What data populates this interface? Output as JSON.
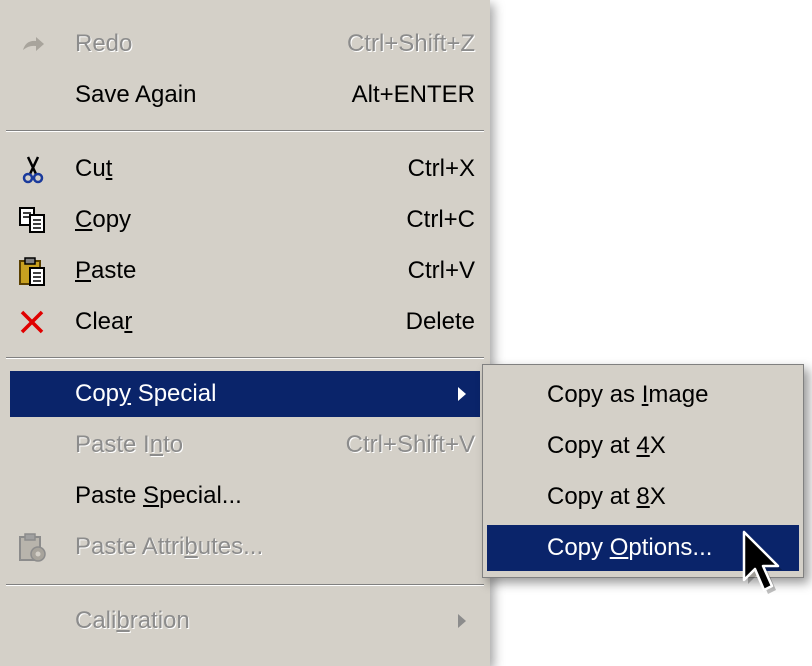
{
  "main_menu": {
    "items": [
      {
        "pre": "Redo",
        "u": "",
        "post": "",
        "shortcut": "Ctrl+Shift+Z",
        "icon": "redo-icon"
      },
      {
        "pre": "Save Again",
        "u": "",
        "post": "",
        "shortcut": "Alt+ENTER"
      },
      {
        "pre": "Cu",
        "u": "t",
        "post": "",
        "shortcut": "Ctrl+X",
        "icon": "scissors-icon"
      },
      {
        "pre": "",
        "u": "C",
        "post": "opy",
        "shortcut": "Ctrl+C",
        "icon": "copy-icon"
      },
      {
        "pre": "",
        "u": "P",
        "post": "aste",
        "shortcut": "Ctrl+V",
        "icon": "clipboard-icon"
      },
      {
        "pre": "Clea",
        "u": "r",
        "post": "",
        "shortcut": "Delete",
        "icon": "delete-x-icon"
      },
      {
        "pre": "Cop",
        "u": "y",
        "post": " Special",
        "shortcut": ""
      },
      {
        "pre": "Paste I",
        "u": "n",
        "post": "to",
        "shortcut": "Ctrl+Shift+V"
      },
      {
        "pre": "Paste ",
        "u": "S",
        "post": "pecial...",
        "shortcut": ""
      },
      {
        "pre": "Paste Attri",
        "u": "b",
        "post": "utes...",
        "shortcut": "",
        "icon": "paste-attributes-icon"
      },
      {
        "pre": "Cali",
        "u": "b",
        "post": "ration",
        "shortcut": ""
      }
    ]
  },
  "submenu": {
    "items": [
      {
        "pre": "Copy as ",
        "u": "I",
        "post": "mage"
      },
      {
        "pre": "Copy at ",
        "u": "4",
        "post": "X"
      },
      {
        "pre": "Copy at ",
        "u": "8",
        "post": "X"
      },
      {
        "pre": "Copy ",
        "u": "O",
        "post": "ptions..."
      }
    ]
  },
  "colors": {
    "menu_bg": "#d4d0c8",
    "highlight": "#0a246a",
    "disabled_text": "#8c8c8c"
  }
}
